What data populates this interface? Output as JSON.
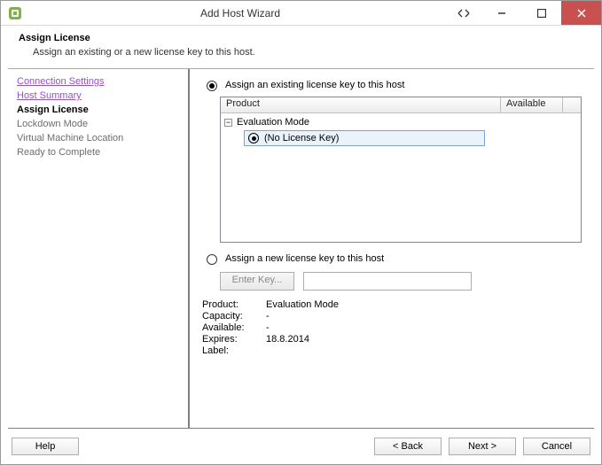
{
  "titlebar": {
    "title": "Add Host Wizard"
  },
  "header": {
    "title": "Assign License",
    "subtitle": "Assign an existing or a new license key to this host."
  },
  "sidebar": {
    "items": [
      {
        "label": "Connection Settings",
        "type": "link"
      },
      {
        "label": "Host Summary",
        "type": "link"
      },
      {
        "label": "Assign License",
        "type": "current"
      },
      {
        "label": "Lockdown Mode",
        "type": "step"
      },
      {
        "label": "Virtual Machine Location",
        "type": "step"
      },
      {
        "label": "Ready to Complete",
        "type": "step"
      }
    ]
  },
  "content": {
    "radio_existing_label": "Assign an existing license key to this host",
    "radio_new_label": "Assign a new license key to this host",
    "tree_headers": {
      "product": "Product",
      "available": "Available"
    },
    "tree_group": "Evaluation Mode",
    "tree_leaf": "(No License Key)",
    "enter_key_btn": "Enter Key...",
    "summary": {
      "product_k": "Product:",
      "product_v": "Evaluation Mode",
      "capacity_k": "Capacity:",
      "capacity_v": "-",
      "available_k": "Available:",
      "available_v": "-",
      "expires_k": "Expires:",
      "expires_v": "18.8.2014",
      "label_k": "Label:",
      "label_v": ""
    }
  },
  "footer": {
    "help": "Help",
    "back": "< Back",
    "next": "Next >",
    "cancel": "Cancel"
  }
}
